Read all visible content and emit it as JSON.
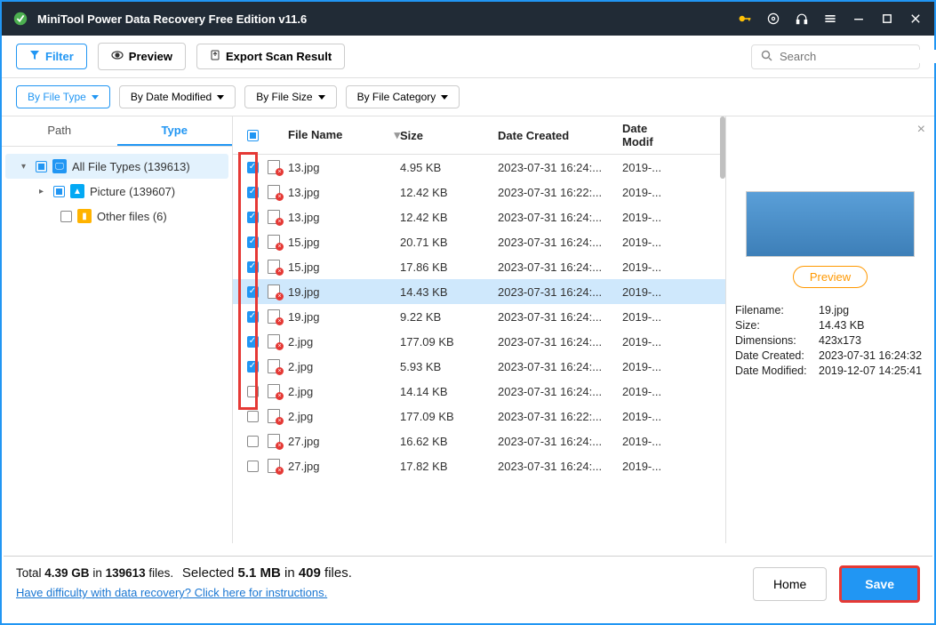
{
  "title": "MiniTool Power Data Recovery Free Edition v11.6",
  "toolbar": {
    "filter": "Filter",
    "preview": "Preview",
    "export": "Export Scan Result",
    "search_placeholder": "Search"
  },
  "filters": {
    "by_file_type": "By File Type",
    "by_date_modified": "By Date Modified",
    "by_file_size": "By File Size",
    "by_file_category": "By File Category"
  },
  "sidebar": {
    "tab_path": "Path",
    "tab_type": "Type",
    "tree": {
      "all": "All File Types (139613)",
      "picture": "Picture (139607)",
      "other": "Other files (6)"
    }
  },
  "columns": {
    "name": "File Name",
    "size": "Size",
    "created": "Date Created",
    "modified": "Date Modif"
  },
  "files": [
    {
      "checked": true,
      "name": "13.jpg",
      "size": "4.95 KB",
      "created": "2023-07-31 16:24:...",
      "modified": "2019-...",
      "selected": false
    },
    {
      "checked": true,
      "name": "13.jpg",
      "size": "12.42 KB",
      "created": "2023-07-31 16:22:...",
      "modified": "2019-...",
      "selected": false
    },
    {
      "checked": true,
      "name": "13.jpg",
      "size": "12.42 KB",
      "created": "2023-07-31 16:24:...",
      "modified": "2019-...",
      "selected": false
    },
    {
      "checked": true,
      "name": "15.jpg",
      "size": "20.71 KB",
      "created": "2023-07-31 16:24:...",
      "modified": "2019-...",
      "selected": false
    },
    {
      "checked": true,
      "name": "15.jpg",
      "size": "17.86 KB",
      "created": "2023-07-31 16:24:...",
      "modified": "2019-...",
      "selected": false
    },
    {
      "checked": true,
      "name": "19.jpg",
      "size": "14.43 KB",
      "created": "2023-07-31 16:24:...",
      "modified": "2019-...",
      "selected": true
    },
    {
      "checked": true,
      "name": "19.jpg",
      "size": "9.22 KB",
      "created": "2023-07-31 16:24:...",
      "modified": "2019-...",
      "selected": false
    },
    {
      "checked": true,
      "name": "2.jpg",
      "size": "177.09 KB",
      "created": "2023-07-31 16:24:...",
      "modified": "2019-...",
      "selected": false
    },
    {
      "checked": true,
      "name": "2.jpg",
      "size": "5.93 KB",
      "created": "2023-07-31 16:24:...",
      "modified": "2019-...",
      "selected": false
    },
    {
      "checked": false,
      "name": "2.jpg",
      "size": "14.14 KB",
      "created": "2023-07-31 16:24:...",
      "modified": "2019-...",
      "selected": false
    },
    {
      "checked": false,
      "name": "2.jpg",
      "size": "177.09 KB",
      "created": "2023-07-31 16:22:...",
      "modified": "2019-...",
      "selected": false
    },
    {
      "checked": false,
      "name": "27.jpg",
      "size": "16.62 KB",
      "created": "2023-07-31 16:24:...",
      "modified": "2019-...",
      "selected": false
    },
    {
      "checked": false,
      "name": "27.jpg",
      "size": "17.82 KB",
      "created": "2023-07-31 16:24:...",
      "modified": "2019-...",
      "selected": false
    }
  ],
  "preview": {
    "button": "Preview",
    "filename_label": "Filename:",
    "filename": "19.jpg",
    "size_label": "Size:",
    "size": "14.43 KB",
    "dimensions_label": "Dimensions:",
    "dimensions": "423x173",
    "created_label": "Date Created:",
    "created": "2023-07-31 16:24:32",
    "modified_label": "Date Modified:",
    "modified": "2019-12-07 14:25:41"
  },
  "bottom": {
    "total_prefix": "Total ",
    "total_size": "4.39 GB",
    "total_in": " in ",
    "total_files": "139613",
    "total_suffix": " files.",
    "selected_prefix": "Selected ",
    "selected_size": "5.1 MB",
    "selected_in": " in ",
    "selected_files": "409",
    "selected_suffix": " files.",
    "help": "Have difficulty with data recovery? Click here for instructions.",
    "home": "Home",
    "save": "Save"
  }
}
